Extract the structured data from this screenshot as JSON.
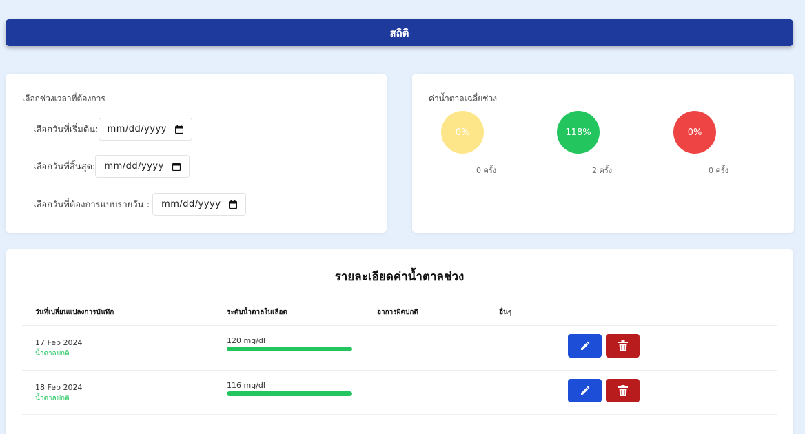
{
  "header": {
    "title": "สถิติ"
  },
  "date_card": {
    "title": "เลือกช่วงเวลาที่ต้องการ",
    "start_label": "เลือกวันที่เริ่มต้น:",
    "end_label": "เลือกวันที่สิ้นสุด:",
    "daily_label": "เลือกวันที่ต้องการแบบรายวัน :",
    "placeholder": "mm/dd/yyyy"
  },
  "stats_card": {
    "title": "ค่าน้ำตาลเฉลี่ยช่วง",
    "stats": [
      {
        "percent": "0%",
        "count": "0 ครั้ง",
        "color": "#fde68a"
      },
      {
        "percent": "118%",
        "count": "2 ครั้ง",
        "color": "#22c55e"
      },
      {
        "percent": "0%",
        "count": "0 ครั้ง",
        "color": "#ef4444"
      }
    ]
  },
  "table": {
    "title": "รายละเอียดค่าน้ำตาลช่วง",
    "headers": [
      "วันที่เปลี่ยนแปลงการบันทึก",
      "ระดับน้ำตาลในเลือด",
      "อาการผิดปกติ",
      "อื่นๆ"
    ],
    "rows": [
      {
        "date": "17 Feb 2024",
        "status": "น้ำตาลปกติ",
        "level": "120 mg/dl",
        "fill": 1.0
      },
      {
        "date": "18 Feb 2024",
        "status": "น้ำตาลปกติ",
        "level": "116 mg/dl",
        "fill": 1.0
      }
    ]
  },
  "icons": {
    "edit": "pencil-icon",
    "delete": "trash-icon",
    "calendar": "calendar-icon"
  }
}
